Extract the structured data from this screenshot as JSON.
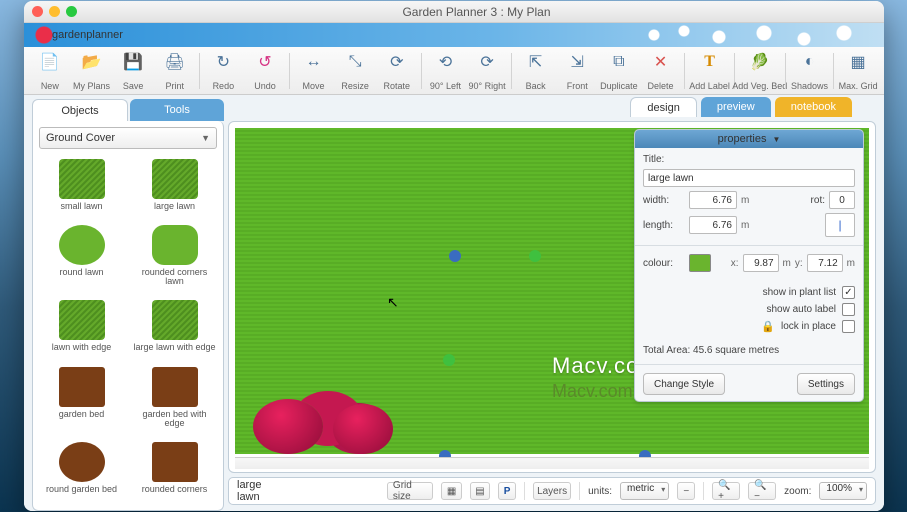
{
  "window_title": "Garden Planner 3 : My  Plan",
  "brand": "gardenplanner",
  "toolbar": [
    {
      "label": "New",
      "icon": "📄"
    },
    {
      "label": "My Plans",
      "icon": "📂"
    },
    {
      "label": "Save",
      "icon": "💾"
    },
    {
      "label": "Print",
      "icon": "🖨"
    },
    {
      "sep": true
    },
    {
      "label": "Redo",
      "icon": "↻"
    },
    {
      "label": "Undo",
      "icon": "↺"
    },
    {
      "sep": true
    },
    {
      "label": "Move",
      "icon": "↔"
    },
    {
      "label": "Resize",
      "icon": "⤡"
    },
    {
      "label": "Rotate",
      "icon": "⟳"
    },
    {
      "sep": true
    },
    {
      "label": "90° Left",
      "icon": "⟲"
    },
    {
      "label": "90° Right",
      "icon": "⟳"
    },
    {
      "sep": true
    },
    {
      "label": "Back",
      "icon": "⇱"
    },
    {
      "label": "Front",
      "icon": "⇲"
    },
    {
      "label": "Duplicate",
      "icon": "⧉"
    },
    {
      "label": "Delete",
      "icon": "✕"
    },
    {
      "sep": true
    },
    {
      "label": "Add Label",
      "icon": "T"
    },
    {
      "sep": true
    },
    {
      "label": "Add Veg. Bed",
      "icon": "🥬"
    },
    {
      "sep": true
    },
    {
      "label": "Shadows",
      "icon": "◐"
    },
    {
      "sep": true
    },
    {
      "label": "Max. Grid",
      "icon": "▦"
    }
  ],
  "sidebar_tabs": {
    "objects": "Objects",
    "tools": "Tools"
  },
  "category": "Ground Cover",
  "objects": [
    {
      "label": "small lawn",
      "sw": "green-sq dark"
    },
    {
      "label": "large lawn",
      "sw": "green-sq dark"
    },
    {
      "label": "round lawn",
      "sw": "green-cir"
    },
    {
      "label": "rounded corners lawn",
      "sw": "green-rsq"
    },
    {
      "label": "lawn with edge",
      "sw": "green-sq dark"
    },
    {
      "label": "large lawn with edge",
      "sw": "green-sq dark"
    },
    {
      "label": "garden bed",
      "sw": "brown-sq"
    },
    {
      "label": "garden bed with edge",
      "sw": "brown-sq"
    },
    {
      "label": "round garden bed",
      "sw": "brown-cir"
    },
    {
      "label": "rounded corners",
      "sw": "brown-sq"
    }
  ],
  "mode_tabs": {
    "design": "design",
    "preview": "preview",
    "notebook": "notebook"
  },
  "properties": {
    "header": "properties",
    "title_label": "Title:",
    "title": "large lawn",
    "width_label": "width:",
    "width": "6.76",
    "width_unit": "m",
    "length_label": "length:",
    "length": "6.76",
    "length_unit": "m",
    "rot_label": "rot:",
    "rot": "0",
    "colour_label": "colour:",
    "x_label": "x:",
    "x": "9.87",
    "x_unit": "m",
    "y_label": "y:",
    "y": "7.12",
    "y_unit": "m",
    "show_plant": "show in plant list",
    "show_plant_checked": true,
    "show_auto": "show auto label",
    "show_auto_checked": false,
    "lock": "lock in place",
    "lock_checked": false,
    "area": "Total Area: 45.6 square metres",
    "change_style": "Change Style",
    "settings": "Settings"
  },
  "status": {
    "selection": "large lawn",
    "grid": "Grid size",
    "layers": "Layers",
    "units_label": "units:",
    "units": "metric",
    "zoom_label": "zoom:",
    "zoom": "100%"
  },
  "watermark": "Macv.com"
}
